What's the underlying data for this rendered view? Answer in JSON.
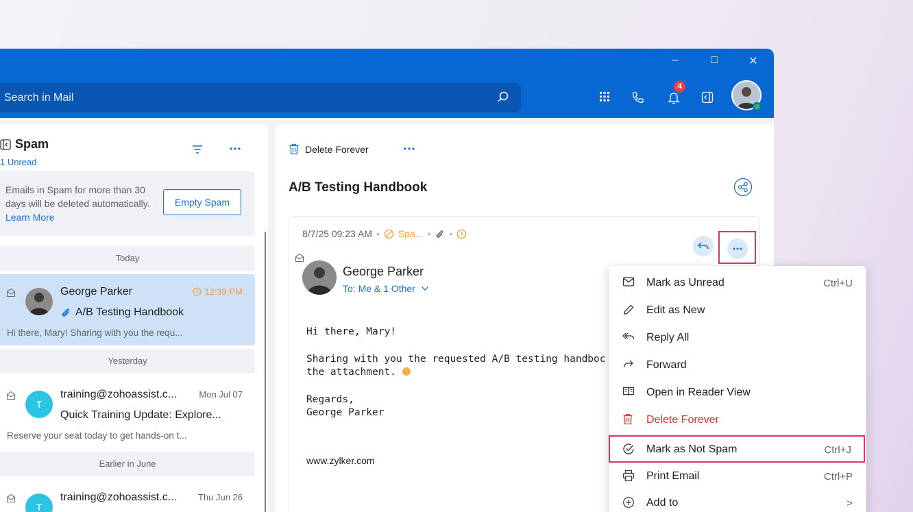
{
  "window_controls": {
    "minimize": "–",
    "maximize": "□",
    "close": "✕"
  },
  "search": {
    "placeholder": "Search in Mail"
  },
  "header": {
    "notification_count": "4"
  },
  "folder": {
    "name": "Spam",
    "unread": "1 Unread"
  },
  "notice": {
    "text": "Emails in Spam for more than 30 days will be deleted automatically. ",
    "link": "Learn More",
    "button": "Empty Spam"
  },
  "groups": [
    "Today",
    "Yesterday",
    "Earlier in  June"
  ],
  "mails": [
    {
      "sender": "George Parker",
      "time": "12:39 PM",
      "subject": "A/B Testing Handbook",
      "preview": "Hi there, Mary! Sharing with you the requ..."
    },
    {
      "sender": "training@zohoassist.c...",
      "time": "Mon Jul 07",
      "subject": "Quick Training Update: Explore...",
      "preview": "Reserve your seat today to get hands-on t...",
      "avatar": "T"
    },
    {
      "sender": "training@zohoassist.c...",
      "time": "Thu Jun 26",
      "avatar": "T"
    }
  ],
  "reader": {
    "toolbar": {
      "delete": "Delete Forever"
    },
    "subject": "A/B Testing Handbook",
    "meta": {
      "datetime": "8/7/25 09:23 AM",
      "folder_tag": "Spa..."
    },
    "sender": {
      "name": "George Parker",
      "to": "To: Me & 1 Other"
    },
    "body": {
      "greeting": "Hi there, Mary!",
      "line1": "Sharing with you the requested A/B testing handboc",
      "line2": "the attachment. ",
      "regards": "Regards,",
      "signature": "George Parker",
      "website": "www.zylker.com"
    }
  },
  "context_menu": {
    "items": [
      {
        "label": "Mark as Unread",
        "shortcut": "Ctrl+U",
        "icon": "envelope-icon"
      },
      {
        "label": "Edit as New",
        "shortcut": "",
        "icon": "pencil-icon"
      },
      {
        "label": "Reply All",
        "shortcut": "",
        "icon": "reply-all-icon"
      },
      {
        "label": "Forward",
        "shortcut": "",
        "icon": "forward-icon"
      },
      {
        "label": "Open in Reader View",
        "shortcut": "",
        "icon": "book-icon"
      },
      {
        "label": "Delete Forever",
        "shortcut": "",
        "icon": "trash-icon"
      },
      {
        "label": "Mark as Not Spam",
        "shortcut": "Ctrl+J",
        "icon": "check-circle-icon"
      },
      {
        "label": "Print Email",
        "shortcut": "Ctrl+P",
        "icon": "printer-icon"
      },
      {
        "label": "Add to",
        "shortcut": ">",
        "icon": "plus-circle-icon"
      }
    ]
  },
  "colors": {
    "accent": "#0868d3",
    "danger": "#e1312c",
    "highlight": "#e0336b",
    "warning": "#f0a13a"
  }
}
